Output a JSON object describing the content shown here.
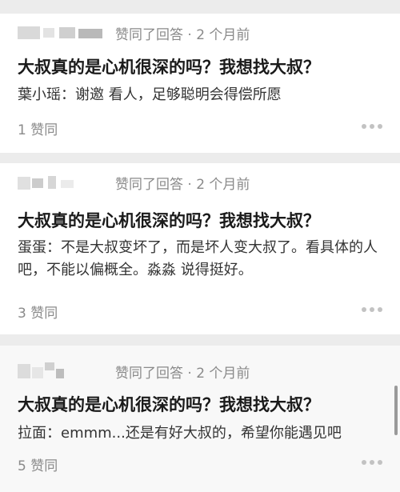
{
  "cards": [
    {
      "meta": "赞同了回答 · 2 个月前",
      "question": "大叔真的是心机很深的吗？我想找大叔？",
      "answer": "葉小瑶：谢邀 看人，足够聪明会得偿所愿",
      "votes": "1 赞同",
      "more_icon": "more-dots-icon"
    },
    {
      "meta": "赞同了回答 · 2 个月前",
      "question": "大叔真的是心机很深的吗？我想找大叔？",
      "answer": "蛋蛋：不是大叔变坏了，而是坏人变大叔了。看具体的人吧，不能以偏概全。淼淼 说得挺好。",
      "votes": "3 赞同",
      "more_icon": "more-dots-icon"
    },
    {
      "meta": "赞同了回答 · 2 个月前",
      "question": "大叔真的是心机很深的吗？我想找大叔？",
      "answer": "拉面：emmm...还是有好大叔的，希望你能遇见吧",
      "votes": "5 赞同",
      "more_icon": "more-dots-icon"
    }
  ],
  "colors": {
    "background": "#ececec",
    "card": "#ffffff",
    "meta_text": "#8a8a8a",
    "title": "#1a1a1a"
  }
}
